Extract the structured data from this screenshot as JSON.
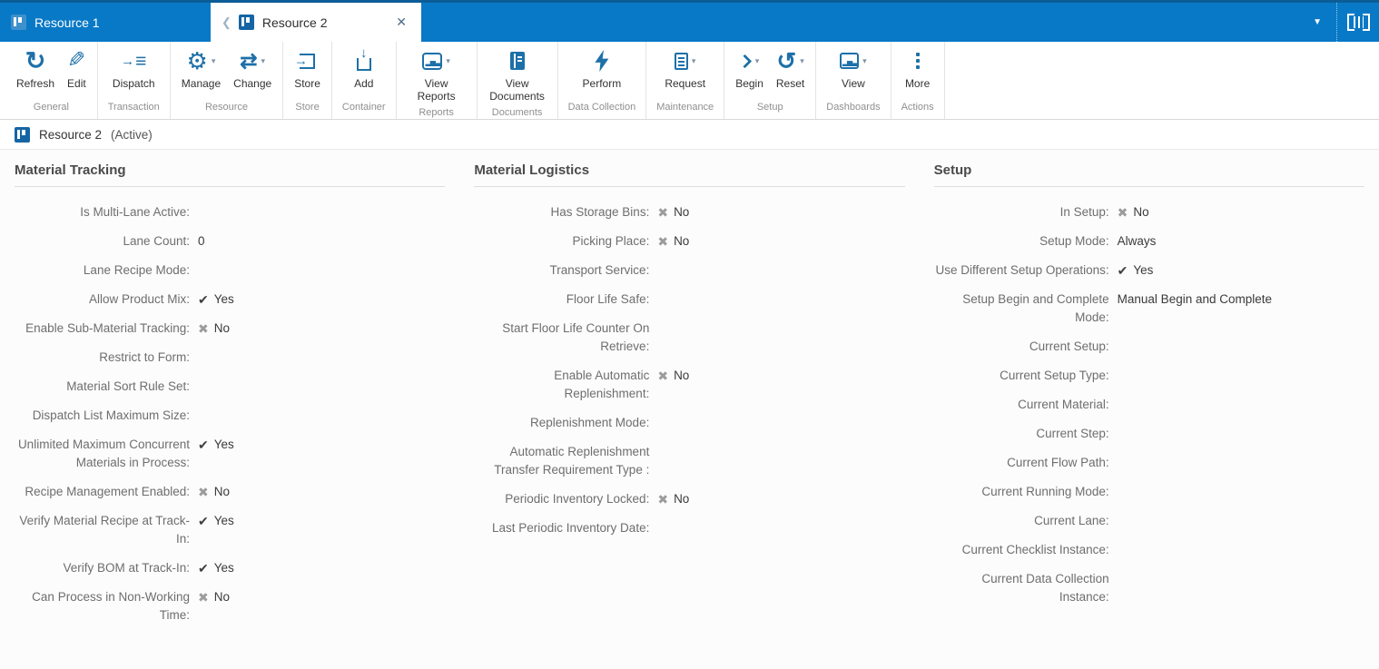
{
  "colors": {
    "titlebar_blue": "#0879c6",
    "titlebar_top_edge": "#0b5d97",
    "ribbon_icon_blue": "#1d70a8",
    "tab_icon_blue": "#1565a5",
    "check_mark": "#3f3f3f",
    "cross_mark": "#9c9c9c"
  },
  "titlebar": {
    "tabs": [
      {
        "label": "Resource 1",
        "active": false,
        "icon": "resource-icon"
      },
      {
        "label": "Resource 2",
        "active": true,
        "icon": "resource-icon"
      }
    ],
    "back_chevron_glyph": "❮",
    "close_glyph": "✕",
    "menu_caret_glyph": "▼",
    "scan_icon": "barcode-scan-icon"
  },
  "ribbon": {
    "dropdown_caret_glyph": "▾",
    "groups": [
      {
        "label": "General",
        "buttons": [
          {
            "label": "Refresh",
            "icon": "refresh-icon",
            "dropdown": false
          },
          {
            "label": "Edit",
            "icon": "edit-icon",
            "dropdown": false
          }
        ]
      },
      {
        "label": "Transaction",
        "buttons": [
          {
            "label": "Dispatch",
            "icon": "dispatch-icon",
            "dropdown": false
          }
        ]
      },
      {
        "label": "Resource",
        "buttons": [
          {
            "label": "Manage",
            "icon": "manage-icon",
            "dropdown": true
          },
          {
            "label": "Change",
            "icon": "change-icon",
            "dropdown": true
          }
        ]
      },
      {
        "label": "Store",
        "buttons": [
          {
            "label": "Store",
            "icon": "store-icon",
            "dropdown": false
          }
        ]
      },
      {
        "label": "Container",
        "buttons": [
          {
            "label": "Add",
            "icon": "add-icon",
            "dropdown": false
          }
        ]
      },
      {
        "label": "Reports",
        "buttons": [
          {
            "label": "View Reports",
            "icon": "view-reports-icon",
            "dropdown": true
          }
        ]
      },
      {
        "label": "Documents",
        "buttons": [
          {
            "label": "View Documents",
            "icon": "view-documents-icon",
            "dropdown": false
          }
        ]
      },
      {
        "label": "Data Collection",
        "buttons": [
          {
            "label": "Perform",
            "icon": "perform-icon",
            "dropdown": false
          }
        ]
      },
      {
        "label": "Maintenance",
        "buttons": [
          {
            "label": "Request",
            "icon": "request-icon",
            "dropdown": true
          }
        ]
      },
      {
        "label": "Setup",
        "buttons": [
          {
            "label": "Begin",
            "icon": "begin-icon",
            "dropdown": true
          },
          {
            "label": "Reset",
            "icon": "reset-icon",
            "dropdown": true
          }
        ]
      },
      {
        "label": "Dashboards",
        "buttons": [
          {
            "label": "View",
            "icon": "view-dashboards-icon",
            "dropdown": true
          }
        ]
      },
      {
        "label": "Actions",
        "buttons": [
          {
            "label": "More",
            "icon": "more-icon",
            "dropdown": false
          }
        ]
      }
    ]
  },
  "breadcrumb": {
    "icon": "resource-icon",
    "title": "Resource 2",
    "status": "(Active)"
  },
  "marks": {
    "check_glyph": "✔",
    "cross_glyph": "✖"
  },
  "sections": [
    {
      "title": "Material Tracking",
      "rows": [
        {
          "label": "Is Multi-Lane Active:",
          "mark": "",
          "value": ""
        },
        {
          "label": "Lane Count:",
          "mark": "",
          "value": "0"
        },
        {
          "label": "Lane Recipe Mode:",
          "mark": "",
          "value": ""
        },
        {
          "label": "Allow Product Mix:",
          "mark": "check",
          "value": "Yes"
        },
        {
          "label": "Enable Sub-Material Tracking:",
          "mark": "cross",
          "value": "No"
        },
        {
          "label": "Restrict to Form:",
          "mark": "",
          "value": ""
        },
        {
          "label": "Material Sort Rule Set:",
          "mark": "",
          "value": ""
        },
        {
          "label": "Dispatch List Maximum Size:",
          "mark": "",
          "value": ""
        },
        {
          "label": "Unlimited Maximum Concurrent Materials in Process:",
          "mark": "check",
          "value": "Yes"
        },
        {
          "label": "Recipe Management Enabled:",
          "mark": "cross",
          "value": "No"
        },
        {
          "label": "Verify Material Recipe at Track-In:",
          "mark": "check",
          "value": "Yes"
        },
        {
          "label": "Verify BOM at Track-In:",
          "mark": "check",
          "value": "Yes"
        },
        {
          "label": "Can Process in Non-Working Time:",
          "mark": "cross",
          "value": "No"
        }
      ]
    },
    {
      "title": "Material Logistics",
      "rows": [
        {
          "label": "Has Storage Bins:",
          "mark": "cross",
          "value": "No"
        },
        {
          "label": "Picking Place:",
          "mark": "cross",
          "value": "No"
        },
        {
          "label": "Transport Service:",
          "mark": "",
          "value": ""
        },
        {
          "label": "Floor Life Safe:",
          "mark": "",
          "value": ""
        },
        {
          "label": "Start Floor Life Counter On Retrieve:",
          "mark": "",
          "value": ""
        },
        {
          "label": "Enable Automatic Replenishment:",
          "mark": "cross",
          "value": "No"
        },
        {
          "label": "Replenishment Mode:",
          "mark": "",
          "value": ""
        },
        {
          "label": "Automatic Replenishment Transfer Requirement Type :",
          "mark": "",
          "value": ""
        },
        {
          "label": "Periodic Inventory Locked:",
          "mark": "cross",
          "value": "No"
        },
        {
          "label": "Last Periodic Inventory Date:",
          "mark": "",
          "value": ""
        }
      ]
    },
    {
      "title": "Setup",
      "rows": [
        {
          "label": "In Setup:",
          "mark": "cross",
          "value": "No"
        },
        {
          "label": "Setup Mode:",
          "mark": "",
          "value": "Always"
        },
        {
          "label": "Use Different Setup Operations:",
          "mark": "check",
          "value": "Yes"
        },
        {
          "label": "Setup Begin and Complete Mode:",
          "mark": "",
          "value": "Manual Begin and Complete"
        },
        {
          "label": "Current Setup:",
          "mark": "",
          "value": ""
        },
        {
          "label": "Current Setup Type:",
          "mark": "",
          "value": ""
        },
        {
          "label": "Current Material:",
          "mark": "",
          "value": ""
        },
        {
          "label": "Current Step:",
          "mark": "",
          "value": ""
        },
        {
          "label": "Current Flow Path:",
          "mark": "",
          "value": ""
        },
        {
          "label": "Current Running Mode:",
          "mark": "",
          "value": ""
        },
        {
          "label": "Current Lane:",
          "mark": "",
          "value": ""
        },
        {
          "label": "Current Checklist Instance:",
          "mark": "",
          "value": ""
        },
        {
          "label": "Current Data Collection Instance:",
          "mark": "",
          "value": ""
        }
      ]
    }
  ]
}
